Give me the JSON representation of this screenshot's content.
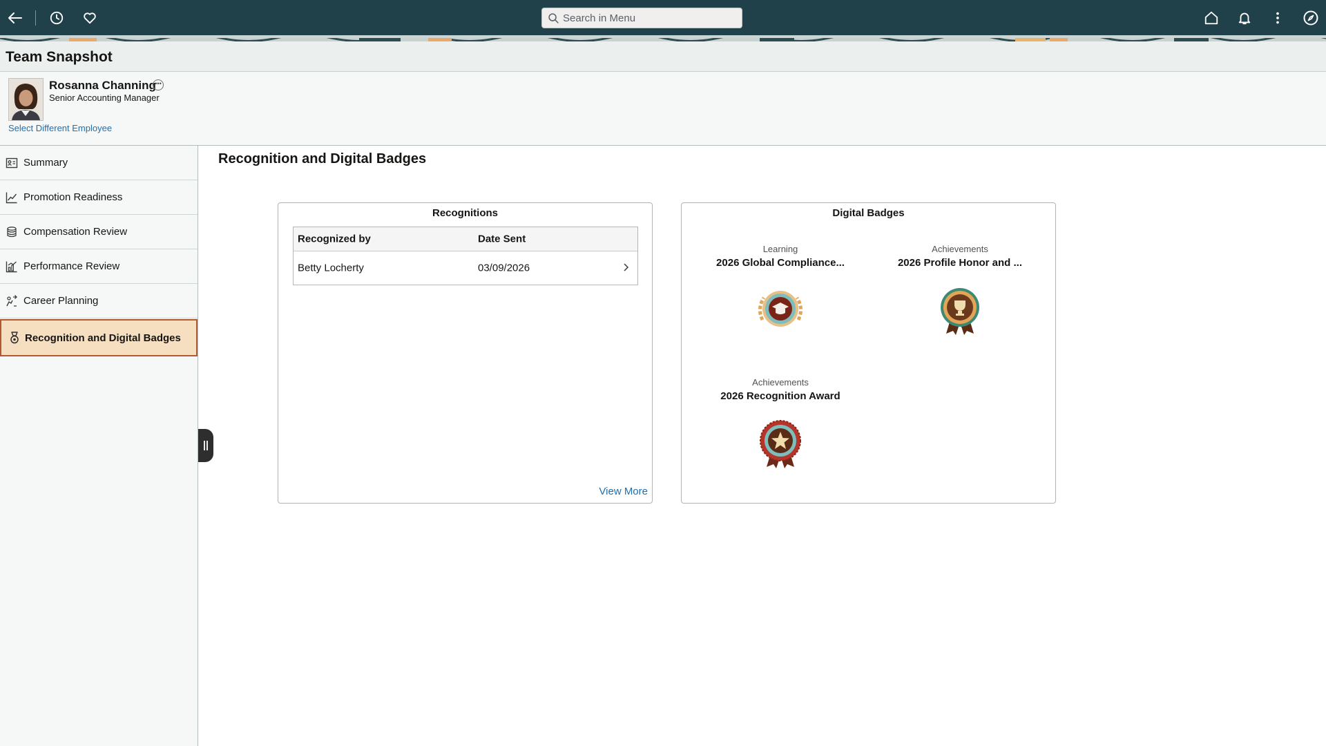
{
  "topbar": {
    "search_placeholder": "Search in Menu",
    "icons": [
      "back-arrow-icon",
      "history-icon",
      "favorites-heart-icon",
      "search-icon",
      "home-icon",
      "notifications-bell-icon",
      "more-actions-icon",
      "navigator-compass-icon"
    ]
  },
  "page": {
    "title": "Team Snapshot"
  },
  "employee": {
    "name": "Rosanna Channing",
    "job_title": "Senior Accounting Manager",
    "select_link": "Select Different Employee"
  },
  "sidebar": {
    "items": [
      {
        "label": "Summary",
        "icon": "id-card-icon"
      },
      {
        "label": "Promotion Readiness",
        "icon": "line-chart-icon"
      },
      {
        "label": "Compensation Review",
        "icon": "coins-stack-icon"
      },
      {
        "label": "Performance Review",
        "icon": "bar-chart-icon"
      },
      {
        "label": "Career Planning",
        "icon": "career-path-icon"
      },
      {
        "label": "Recognition and Digital Badges",
        "icon": "medal-icon",
        "active": true
      }
    ]
  },
  "main": {
    "title": "Recognition and Digital Badges",
    "recognitions": {
      "title": "Recognitions",
      "columns": [
        "Recognized by",
        "Date Sent"
      ],
      "rows": [
        {
          "recognized_by": "Betty Locherty",
          "date_sent": "03/09/2026"
        }
      ],
      "view_more": "View More"
    },
    "badges": {
      "title": "Digital Badges",
      "items": [
        {
          "category": "Learning",
          "name": "2026 Global Compliance...",
          "icon": "graduation-cap-badge-icon"
        },
        {
          "category": "Achievements",
          "name": "2026 Profile Honor and ...",
          "icon": "trophy-ribbon-badge-icon"
        },
        {
          "category": "Achievements",
          "name": "2026 Recognition Award",
          "icon": "star-ribbon-badge-icon"
        }
      ]
    }
  },
  "colors": {
    "topbar_bg": "#20404a",
    "active_nav_bg": "#f6dfc1",
    "active_nav_border": "#b3592f",
    "link": "#1f6fad"
  }
}
